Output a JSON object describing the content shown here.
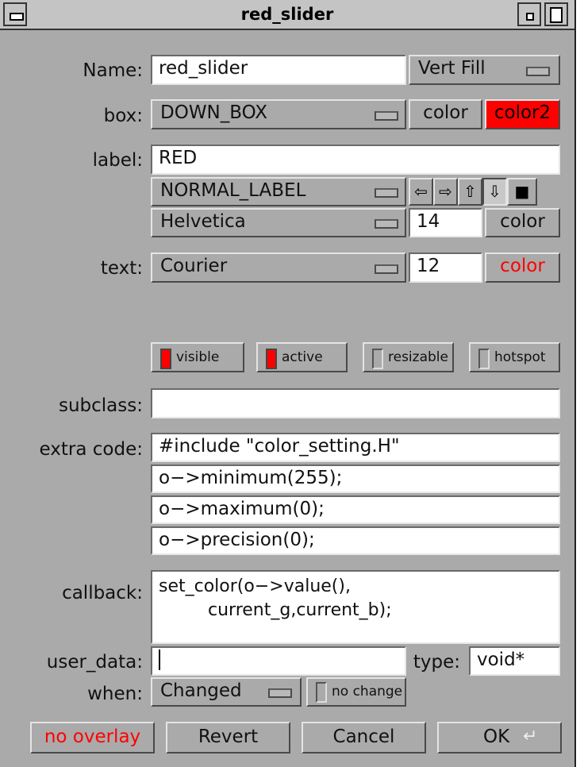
{
  "window": {
    "title": "red_slider"
  },
  "name_row": {
    "label": "Name:",
    "value": "red_slider",
    "fill_button": "Vert Fill"
  },
  "box_row": {
    "label": "box:",
    "value": "DOWN_BOX",
    "color_button": "color",
    "color2_button": "color2"
  },
  "label_row": {
    "label": "label:",
    "value": "RED",
    "label_type": "NORMAL_LABEL",
    "align_icons": [
      "align-left-icon",
      "align-right-icon",
      "align-top-icon",
      "align-bottom-icon",
      "align-inside-icon"
    ],
    "font": "Helvetica",
    "size": "14",
    "color_button": "color"
  },
  "text_row": {
    "label": "text:",
    "font": "Courier",
    "size": "12",
    "color_button": "color"
  },
  "flags": {
    "visible": "visible",
    "active": "active",
    "resizable": "resizable",
    "hotspot": "hotspot",
    "visible_on": true,
    "active_on": true,
    "resizable_on": false,
    "hotspot_on": false
  },
  "subclass": {
    "label": "subclass:",
    "value": ""
  },
  "extra_code": {
    "label": "extra code:",
    "lines": [
      "#include \"color_setting.H\"",
      "o−>minimum(255);",
      "o−>maximum(0);",
      "o−>precision(0);"
    ]
  },
  "callback": {
    "label": "callback:",
    "line1": "set_color(o−>value(),",
    "line2": "current_g,current_b);"
  },
  "user_data": {
    "label": "user_data:",
    "value": "",
    "type_label": "type:",
    "type_value": "void*"
  },
  "when": {
    "label": "when:",
    "value": "Changed",
    "no_change": "no change"
  },
  "buttons": {
    "overlay": "no overlay",
    "revert": "Revert",
    "cancel": "Cancel",
    "ok": "OK"
  },
  "colors": {
    "panel": "#aaaaaa",
    "accent_red": "#ff0000"
  }
}
